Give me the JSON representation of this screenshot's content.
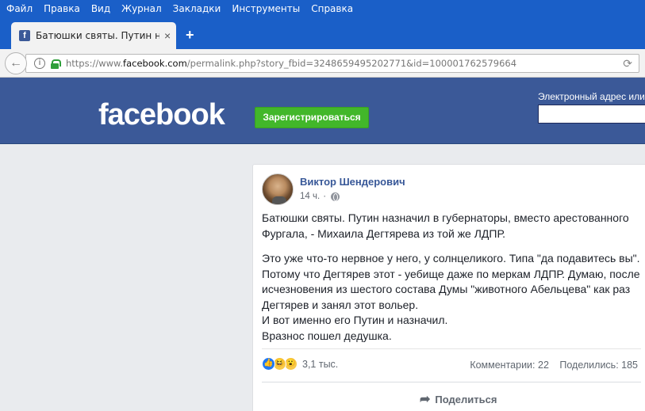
{
  "browser": {
    "menu": [
      "Файл",
      "Правка",
      "Вид",
      "Журнал",
      "Закладки",
      "Инструменты",
      "Справка"
    ],
    "tab_title": "Батюшки святы. Путин наз...",
    "tab_close": "×",
    "new_tab": "+",
    "url_prefix": "https://www.",
    "url_domain": "facebook.com",
    "url_path": "/permalink.php?story_fbid=3248659495202771&id=100001762579664"
  },
  "header": {
    "logo": "facebook",
    "signup_label": "Зарегистрироваться",
    "email_label": "Электронный адрес или"
  },
  "post": {
    "author": "Виктор Шендерович",
    "time": "14 ч.",
    "dot": "·",
    "paragraphs": [
      "Батюшки святы. Путин назначил в губернаторы, вместо арестованного Фургала, - Михаила Дегтярева из той же ЛДПР."
    ],
    "lines": [
      "Это уже что-то нервное у него, у солнцеликого. Типа \"да подавитесь вы\". Потому что Дегтярев этот - уебище даже по меркам ЛДПР. Думаю, после исчезновения из шестого состава Думы \"животного Абельцева\" как раз Дегтярев и занял этот вольер.",
      "И вот именно его Путин и назначил.",
      "Вразнос пошел дедушка."
    ],
    "reaction_count": "3,1 тыс.",
    "comments": "Комментарии: 22",
    "shares": "Поделились: 185",
    "share_label": "Поделиться"
  }
}
